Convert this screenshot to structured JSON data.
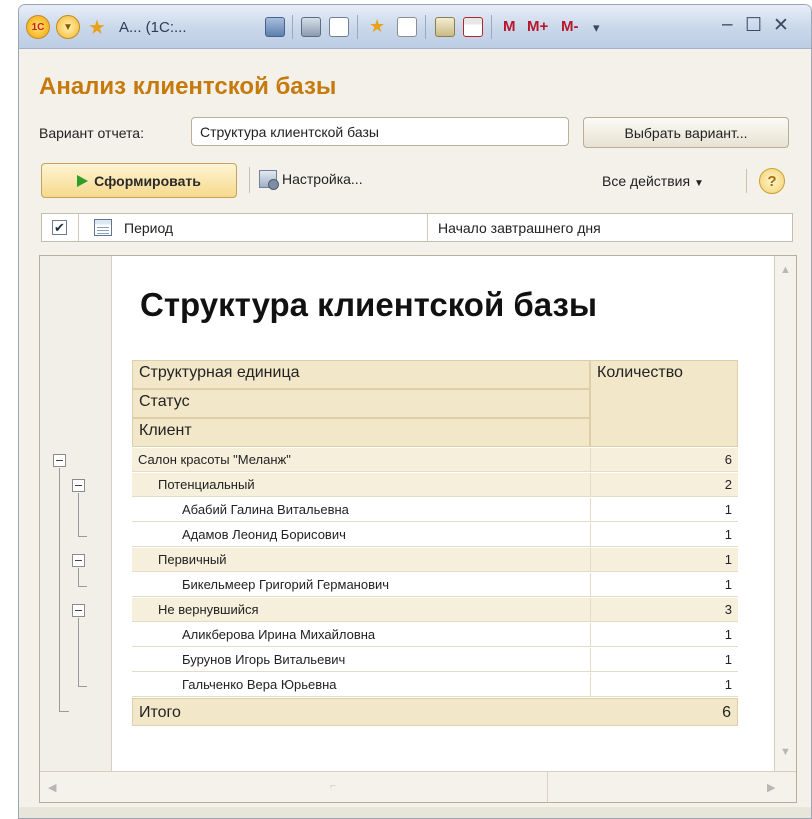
{
  "titlebar": {
    "title": "А... (1С:...",
    "m_labels": [
      "M",
      "M+",
      "M-"
    ],
    "window_buttons": [
      "‒",
      "☐",
      "✕"
    ]
  },
  "heading": "Анализ клиентской базы",
  "variant": {
    "label": "Вариант отчета:",
    "value": "Структура клиентской базы",
    "choose_button": "Выбрать вариант..."
  },
  "toolbar": {
    "generate_button": "Сформировать",
    "settings_button": "Настройка...",
    "all_actions": "Все действия",
    "help": "?"
  },
  "parameter": {
    "checked": true,
    "name": "Период",
    "value": "Начало завтрашнего дня"
  },
  "report": {
    "title": "Структура клиентской базы",
    "headers": {
      "unit": "Структурная единица",
      "status": "Статус",
      "client": "Клиент",
      "quantity": "Количество"
    },
    "rows": [
      {
        "level": 0,
        "name": "Салон красоты \"Меланж\"",
        "qty": "6"
      },
      {
        "level": 1,
        "name": "Потенциальный",
        "qty": "2"
      },
      {
        "level": 2,
        "name": "Абабий Галина Витальевна",
        "qty": "1"
      },
      {
        "level": 2,
        "name": "Адамов Леонид Борисович",
        "qty": "1"
      },
      {
        "level": 1,
        "name": "Первичный",
        "qty": "1"
      },
      {
        "level": 2,
        "name": "Бикельмеер Григорий Германович",
        "qty": "1"
      },
      {
        "level": 1,
        "name": "Не вернувшийся",
        "qty": "3"
      },
      {
        "level": 2,
        "name": "Аликберова Ирина Михайловна",
        "qty": "1"
      },
      {
        "level": 2,
        "name": "Бурунов Игорь Витальевич",
        "qty": "1"
      },
      {
        "level": 2,
        "name": "Гальченко Вера Юрьевна",
        "qty": "1"
      }
    ],
    "total": {
      "label": "Итого",
      "qty": "6"
    }
  },
  "colors": {
    "accent": "#c67a0c",
    "header_fill": "#f2e7c8",
    "group_fill": "#f5efdc"
  }
}
